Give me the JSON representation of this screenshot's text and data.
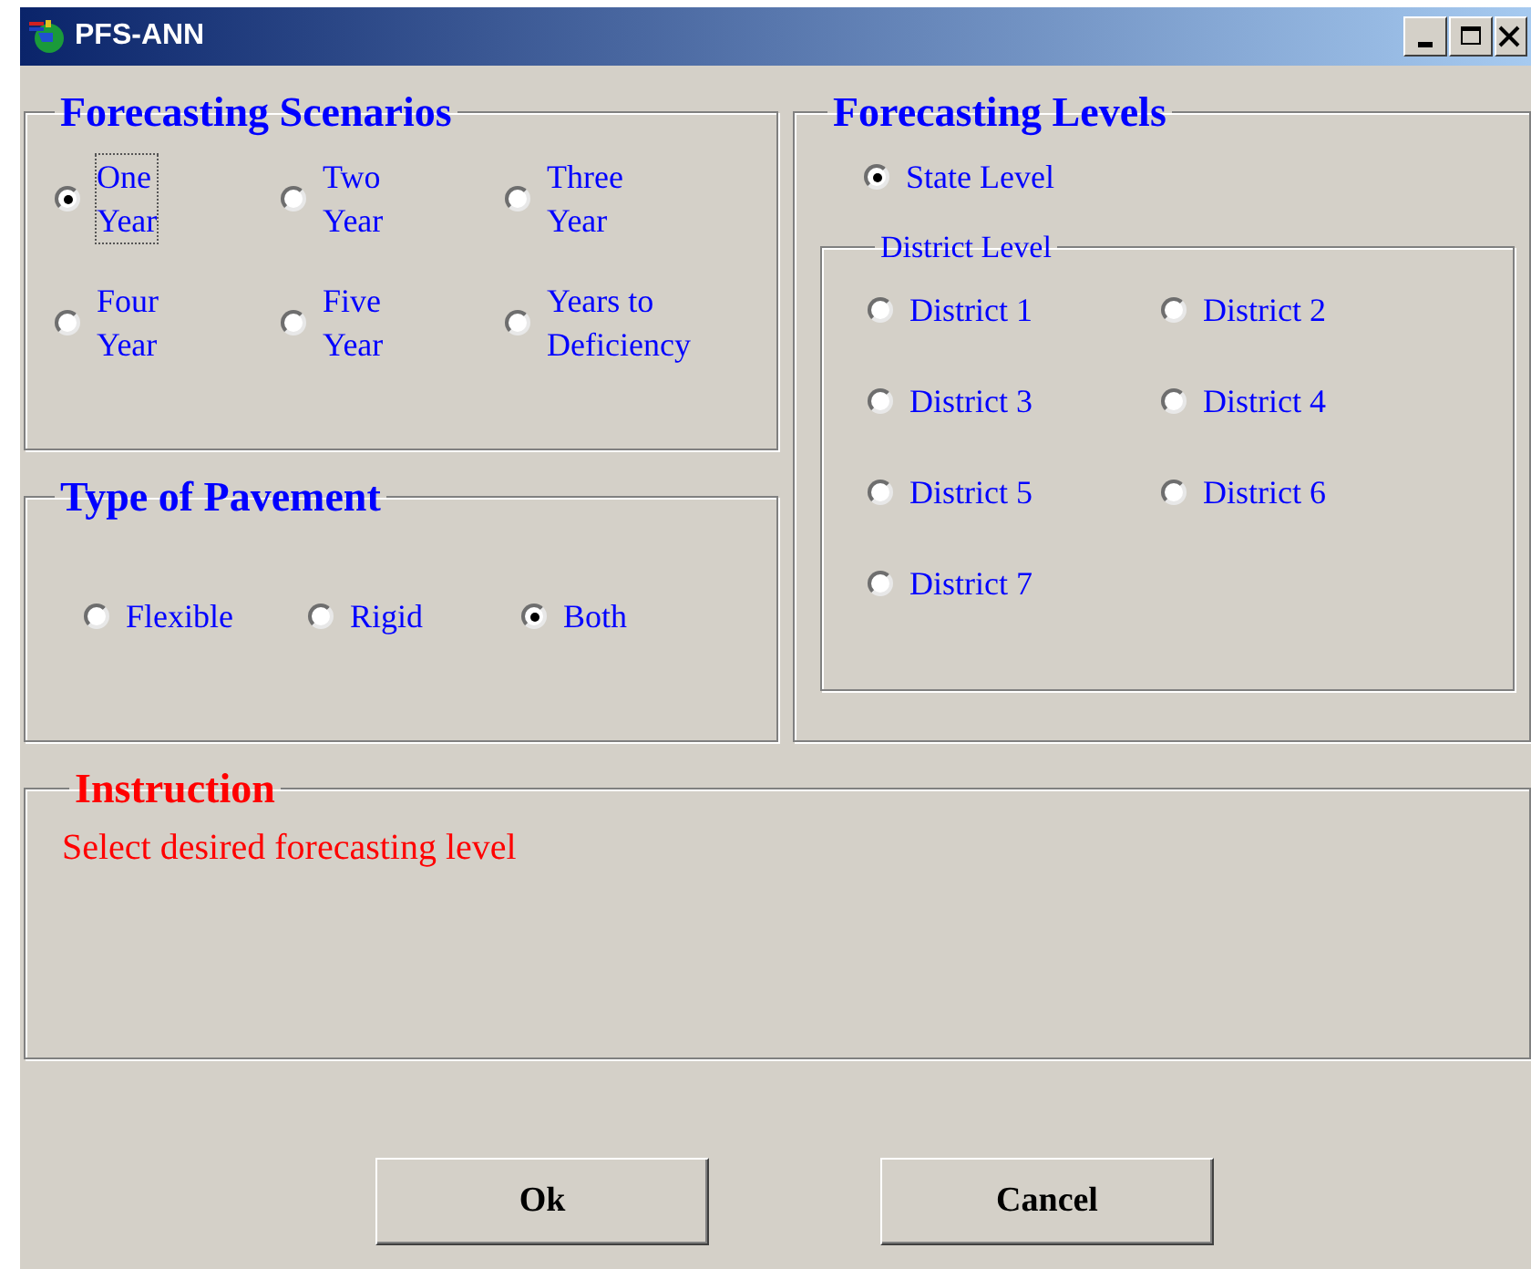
{
  "window": {
    "title": "PFS-ANN"
  },
  "forecasting_scenarios": {
    "title": "Forecasting Scenarios",
    "options": [
      {
        "lines": [
          "One",
          "Year"
        ],
        "selected": true,
        "focused": true
      },
      {
        "lines": [
          "Two",
          "Year"
        ],
        "selected": false,
        "focused": false
      },
      {
        "lines": [
          "Three",
          "Year"
        ],
        "selected": false,
        "focused": false
      },
      {
        "lines": [
          "Four",
          "Year"
        ],
        "selected": false,
        "focused": false
      },
      {
        "lines": [
          "Five",
          "Year"
        ],
        "selected": false,
        "focused": false
      },
      {
        "lines": [
          "Years to",
          "Deficiency"
        ],
        "selected": false,
        "focused": false
      }
    ]
  },
  "type_of_pavement": {
    "title": "Type of Pavement",
    "options": [
      {
        "label": "Flexible",
        "selected": false
      },
      {
        "label": "Rigid",
        "selected": false
      },
      {
        "label": "Both",
        "selected": true
      }
    ]
  },
  "forecasting_levels": {
    "title": "Forecasting Levels",
    "state_option": {
      "label": "State Level",
      "selected": true
    },
    "district_level": {
      "title": "District Level",
      "options": [
        {
          "label": "District 1",
          "selected": false
        },
        {
          "label": "District 2",
          "selected": false
        },
        {
          "label": "District 3",
          "selected": false
        },
        {
          "label": "District 4",
          "selected": false
        },
        {
          "label": "District 5",
          "selected": false
        },
        {
          "label": "District 6",
          "selected": false
        },
        {
          "label": "District 7",
          "selected": false
        }
      ]
    }
  },
  "instruction": {
    "title": "Instruction",
    "text": "Select desired forecasting level"
  },
  "buttons": [
    "Ok",
    "Cancel"
  ]
}
